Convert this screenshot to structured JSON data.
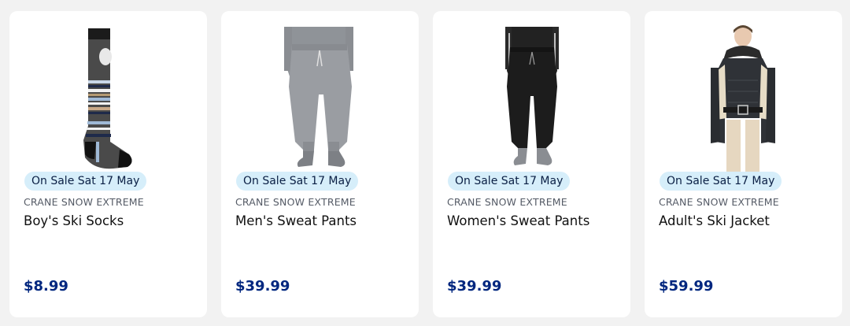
{
  "products": [
    {
      "badge": "On Sale Sat 17 May",
      "brand": "CRANE SNOW EXTREME",
      "title": "Boy's Ski Socks",
      "price": "$8.99",
      "image_icon": "ski-socks-image"
    },
    {
      "badge": "On Sale Sat 17 May",
      "brand": "CRANE SNOW EXTREME",
      "title": "Men's Sweat Pants",
      "price": "$39.99",
      "image_icon": "grey-sweat-pants-image"
    },
    {
      "badge": "On Sale Sat 17 May",
      "brand": "CRANE SNOW EXTREME",
      "title": "Women's Sweat Pants",
      "price": "$39.99",
      "image_icon": "black-sweat-pants-image"
    },
    {
      "badge": "On Sale Sat 17 May",
      "brand": "CRANE SNOW EXTREME",
      "title": "Adult's Ski Jacket",
      "price": "$59.99",
      "image_icon": "ski-jacket-image"
    }
  ],
  "colors": {
    "badge_bg": "#d6eefa",
    "price": "#00267f",
    "card_bg": "#ffffff",
    "page_bg": "#f2f2f2"
  }
}
